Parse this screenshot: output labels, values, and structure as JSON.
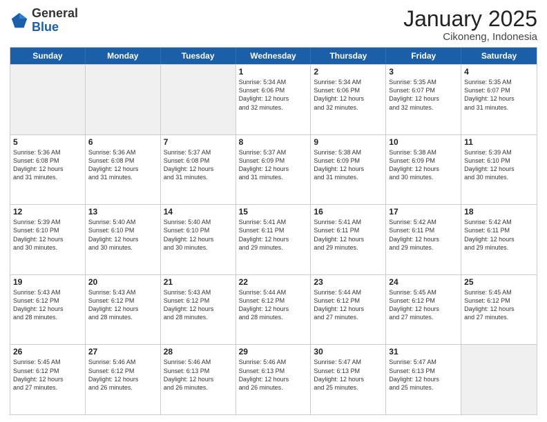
{
  "header": {
    "logo_general": "General",
    "logo_blue": "Blue",
    "title": "January 2025",
    "subtitle": "Cikoneng, Indonesia"
  },
  "days_of_week": [
    "Sunday",
    "Monday",
    "Tuesday",
    "Wednesday",
    "Thursday",
    "Friday",
    "Saturday"
  ],
  "weeks": [
    [
      {
        "day": "",
        "info": "",
        "shaded": true
      },
      {
        "day": "",
        "info": "",
        "shaded": true
      },
      {
        "day": "",
        "info": "",
        "shaded": true
      },
      {
        "day": "1",
        "info": "Sunrise: 5:34 AM\nSunset: 6:06 PM\nDaylight: 12 hours\nand 32 minutes.",
        "shaded": false
      },
      {
        "day": "2",
        "info": "Sunrise: 5:34 AM\nSunset: 6:06 PM\nDaylight: 12 hours\nand 32 minutes.",
        "shaded": false
      },
      {
        "day": "3",
        "info": "Sunrise: 5:35 AM\nSunset: 6:07 PM\nDaylight: 12 hours\nand 32 minutes.",
        "shaded": false
      },
      {
        "day": "4",
        "info": "Sunrise: 5:35 AM\nSunset: 6:07 PM\nDaylight: 12 hours\nand 31 minutes.",
        "shaded": false
      }
    ],
    [
      {
        "day": "5",
        "info": "Sunrise: 5:36 AM\nSunset: 6:08 PM\nDaylight: 12 hours\nand 31 minutes.",
        "shaded": false
      },
      {
        "day": "6",
        "info": "Sunrise: 5:36 AM\nSunset: 6:08 PM\nDaylight: 12 hours\nand 31 minutes.",
        "shaded": false
      },
      {
        "day": "7",
        "info": "Sunrise: 5:37 AM\nSunset: 6:08 PM\nDaylight: 12 hours\nand 31 minutes.",
        "shaded": false
      },
      {
        "day": "8",
        "info": "Sunrise: 5:37 AM\nSunset: 6:09 PM\nDaylight: 12 hours\nand 31 minutes.",
        "shaded": false
      },
      {
        "day": "9",
        "info": "Sunrise: 5:38 AM\nSunset: 6:09 PM\nDaylight: 12 hours\nand 31 minutes.",
        "shaded": false
      },
      {
        "day": "10",
        "info": "Sunrise: 5:38 AM\nSunset: 6:09 PM\nDaylight: 12 hours\nand 30 minutes.",
        "shaded": false
      },
      {
        "day": "11",
        "info": "Sunrise: 5:39 AM\nSunset: 6:10 PM\nDaylight: 12 hours\nand 30 minutes.",
        "shaded": false
      }
    ],
    [
      {
        "day": "12",
        "info": "Sunrise: 5:39 AM\nSunset: 6:10 PM\nDaylight: 12 hours\nand 30 minutes.",
        "shaded": false
      },
      {
        "day": "13",
        "info": "Sunrise: 5:40 AM\nSunset: 6:10 PM\nDaylight: 12 hours\nand 30 minutes.",
        "shaded": false
      },
      {
        "day": "14",
        "info": "Sunrise: 5:40 AM\nSunset: 6:10 PM\nDaylight: 12 hours\nand 30 minutes.",
        "shaded": false
      },
      {
        "day": "15",
        "info": "Sunrise: 5:41 AM\nSunset: 6:11 PM\nDaylight: 12 hours\nand 29 minutes.",
        "shaded": false
      },
      {
        "day": "16",
        "info": "Sunrise: 5:41 AM\nSunset: 6:11 PM\nDaylight: 12 hours\nand 29 minutes.",
        "shaded": false
      },
      {
        "day": "17",
        "info": "Sunrise: 5:42 AM\nSunset: 6:11 PM\nDaylight: 12 hours\nand 29 minutes.",
        "shaded": false
      },
      {
        "day": "18",
        "info": "Sunrise: 5:42 AM\nSunset: 6:11 PM\nDaylight: 12 hours\nand 29 minutes.",
        "shaded": false
      }
    ],
    [
      {
        "day": "19",
        "info": "Sunrise: 5:43 AM\nSunset: 6:12 PM\nDaylight: 12 hours\nand 28 minutes.",
        "shaded": false
      },
      {
        "day": "20",
        "info": "Sunrise: 5:43 AM\nSunset: 6:12 PM\nDaylight: 12 hours\nand 28 minutes.",
        "shaded": false
      },
      {
        "day": "21",
        "info": "Sunrise: 5:43 AM\nSunset: 6:12 PM\nDaylight: 12 hours\nand 28 minutes.",
        "shaded": false
      },
      {
        "day": "22",
        "info": "Sunrise: 5:44 AM\nSunset: 6:12 PM\nDaylight: 12 hours\nand 28 minutes.",
        "shaded": false
      },
      {
        "day": "23",
        "info": "Sunrise: 5:44 AM\nSunset: 6:12 PM\nDaylight: 12 hours\nand 27 minutes.",
        "shaded": false
      },
      {
        "day": "24",
        "info": "Sunrise: 5:45 AM\nSunset: 6:12 PM\nDaylight: 12 hours\nand 27 minutes.",
        "shaded": false
      },
      {
        "day": "25",
        "info": "Sunrise: 5:45 AM\nSunset: 6:12 PM\nDaylight: 12 hours\nand 27 minutes.",
        "shaded": false
      }
    ],
    [
      {
        "day": "26",
        "info": "Sunrise: 5:45 AM\nSunset: 6:12 PM\nDaylight: 12 hours\nand 27 minutes.",
        "shaded": false
      },
      {
        "day": "27",
        "info": "Sunrise: 5:46 AM\nSunset: 6:12 PM\nDaylight: 12 hours\nand 26 minutes.",
        "shaded": false
      },
      {
        "day": "28",
        "info": "Sunrise: 5:46 AM\nSunset: 6:13 PM\nDaylight: 12 hours\nand 26 minutes.",
        "shaded": false
      },
      {
        "day": "29",
        "info": "Sunrise: 5:46 AM\nSunset: 6:13 PM\nDaylight: 12 hours\nand 26 minutes.",
        "shaded": false
      },
      {
        "day": "30",
        "info": "Sunrise: 5:47 AM\nSunset: 6:13 PM\nDaylight: 12 hours\nand 25 minutes.",
        "shaded": false
      },
      {
        "day": "31",
        "info": "Sunrise: 5:47 AM\nSunset: 6:13 PM\nDaylight: 12 hours\nand 25 minutes.",
        "shaded": false
      },
      {
        "day": "",
        "info": "",
        "shaded": true
      }
    ]
  ]
}
